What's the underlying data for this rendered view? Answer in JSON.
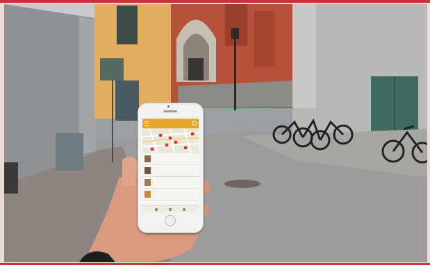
{
  "scene": {
    "subject": "hand-holding-smartphone",
    "setting": "city-street-with-church-and-bicycles"
  },
  "colors": {
    "frame_rule": "#c4343a",
    "app_header": "#e8a52b",
    "map_pin": "#d9342b"
  },
  "app": {
    "header_title": "",
    "items": [
      {
        "title": "",
        "subtitle": "",
        "distance": ""
      },
      {
        "title": "",
        "subtitle": "",
        "distance": ""
      },
      {
        "title": "",
        "subtitle": "",
        "distance": ""
      },
      {
        "title": "",
        "subtitle": "",
        "distance": ""
      }
    ],
    "icons": [
      "menu-icon",
      "search-icon"
    ]
  }
}
